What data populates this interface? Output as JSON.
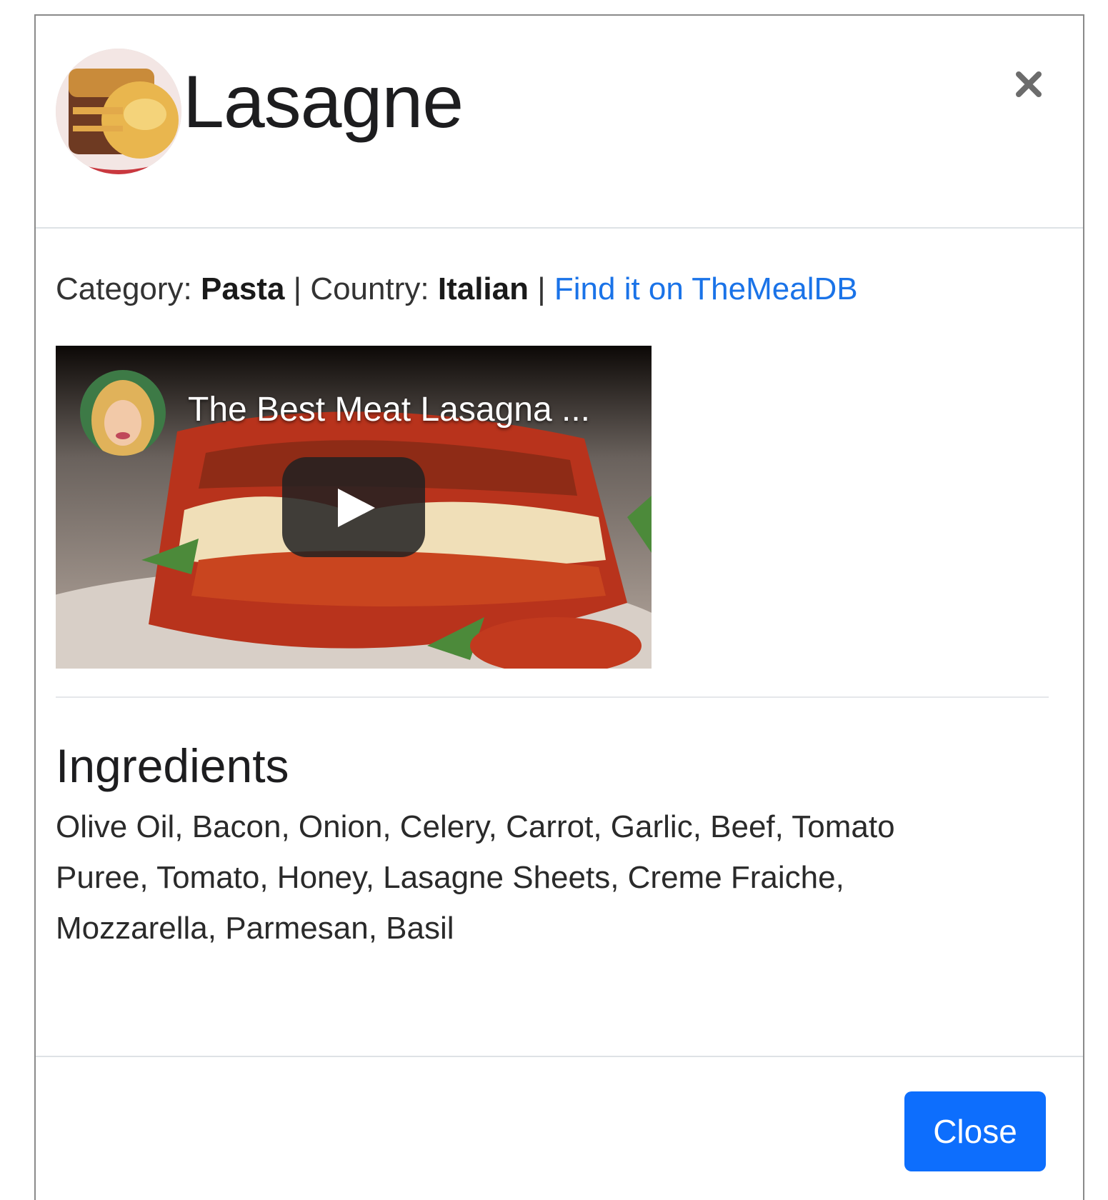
{
  "modal": {
    "title": "Lasagne",
    "close_icon": "close-icon",
    "meta": {
      "category_label": "Category:",
      "category_value": "Pasta",
      "separator1": " | ",
      "country_label": "Country:",
      "country_value": "Italian",
      "separator2": " | ",
      "link_text": "Find it on TheMealDB"
    },
    "video": {
      "title": "The Best Meat Lasagna ...",
      "play_icon": "play-icon"
    },
    "ingredients_heading": "Ingredients",
    "ingredients_text": "Olive Oil, Bacon, Onion, Celery, Carrot, Garlic, Beef, Tomato Puree, Tomato, Honey, Lasagne Sheets, Creme Fraiche, Mozzarella, Parmesan, Basil",
    "footer": {
      "close_label": "Close"
    }
  },
  "colors": {
    "primary": "#0d6efd",
    "link": "#1a73e8",
    "divider": "#dee2e6"
  }
}
